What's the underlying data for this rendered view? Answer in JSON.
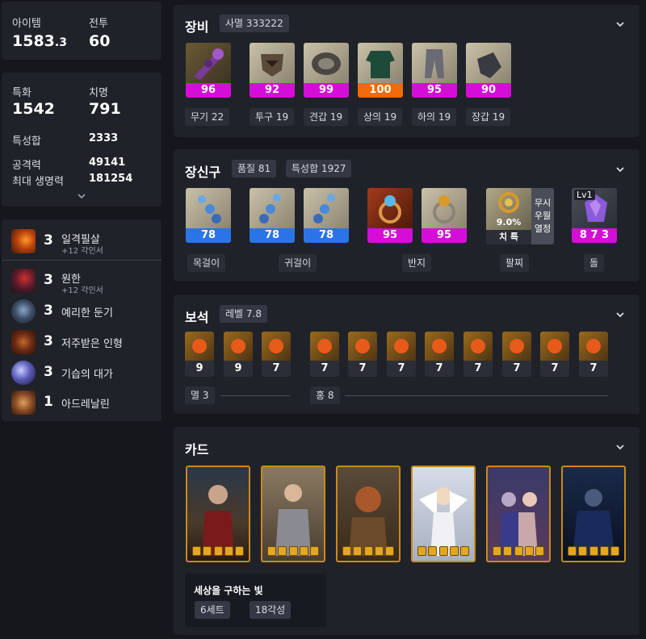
{
  "stats_top": {
    "item_level_label": "아이템",
    "item_level_value": "1583",
    "item_level_decimal": ".3",
    "combat_label": "전투",
    "combat_value": "60"
  },
  "stats_main": {
    "spec_label": "특화",
    "spec_value": "1542",
    "crit_label": "치명",
    "crit_value": "791",
    "total_label": "특성합",
    "total_value": "2333",
    "atk_label": "공격력",
    "atk_value": "49141",
    "hp_label": "최대 생명력",
    "hp_value": "181254"
  },
  "engravings": [
    {
      "level": "3",
      "name": "일격필살",
      "sub": "+12 각인서"
    },
    {
      "level": "3",
      "name": "원한",
      "sub": "+12 각인서"
    },
    {
      "level": "3",
      "name": "예리한 둔기",
      "sub": ""
    },
    {
      "level": "3",
      "name": "저주받은 인형",
      "sub": ""
    },
    {
      "level": "3",
      "name": "기습의 대가",
      "sub": ""
    },
    {
      "level": "1",
      "name": "아드레날린",
      "sub": ""
    }
  ],
  "equipment": {
    "title": "장비",
    "badge": "사멸 333222",
    "items": [
      {
        "quality": "96",
        "label": "무기 22",
        "color": "#d40ed6"
      },
      {
        "quality": "92",
        "label": "투구 19",
        "color": "#d40ed6"
      },
      {
        "quality": "99",
        "label": "견갑 19",
        "color": "#d40ed6"
      },
      {
        "quality": "100",
        "label": "상의 19",
        "color": "#f06a08"
      },
      {
        "quality": "95",
        "label": "하의 19",
        "color": "#d40ed6"
      },
      {
        "quality": "90",
        "label": "장갑 19",
        "color": "#d40ed6"
      }
    ]
  },
  "accessories": {
    "title": "장신구",
    "badge1": "품질 81",
    "badge2": "특성합 1927",
    "items": [
      {
        "quality": "78"
      },
      {
        "quality": "78"
      },
      {
        "quality": "78"
      },
      {
        "quality": "95"
      },
      {
        "quality": "95"
      }
    ],
    "bracelet": {
      "pct": "9.0%",
      "stats": "치 특",
      "effects": [
        "무시",
        "우월",
        "열정"
      ]
    },
    "stone": {
      "level": "Lv1",
      "value": "8 7 3"
    },
    "labels": {
      "necklace": "목걸이",
      "earring": "귀걸이",
      "ring": "반지",
      "bracelet": "팔찌",
      "stone": "돌"
    }
  },
  "gems": {
    "title": "보석",
    "badge": "레벨 7.8",
    "levels": [
      "9",
      "9",
      "7",
      "7",
      "7",
      "7",
      "7",
      "7",
      "7",
      "7",
      "7"
    ],
    "group1": "멸 3",
    "group2": "홍 8"
  },
  "cards": {
    "title": "카드",
    "set_name": "세상을 구하는 빛",
    "set_chip1": "6세트",
    "set_chip2": "18각성"
  },
  "colors": {
    "accent_pink": "#d40ed6",
    "accent_orange": "#f06a08",
    "accent_blue": "#2a74e8",
    "panel": "#1f2229",
    "background": "#15171c"
  }
}
